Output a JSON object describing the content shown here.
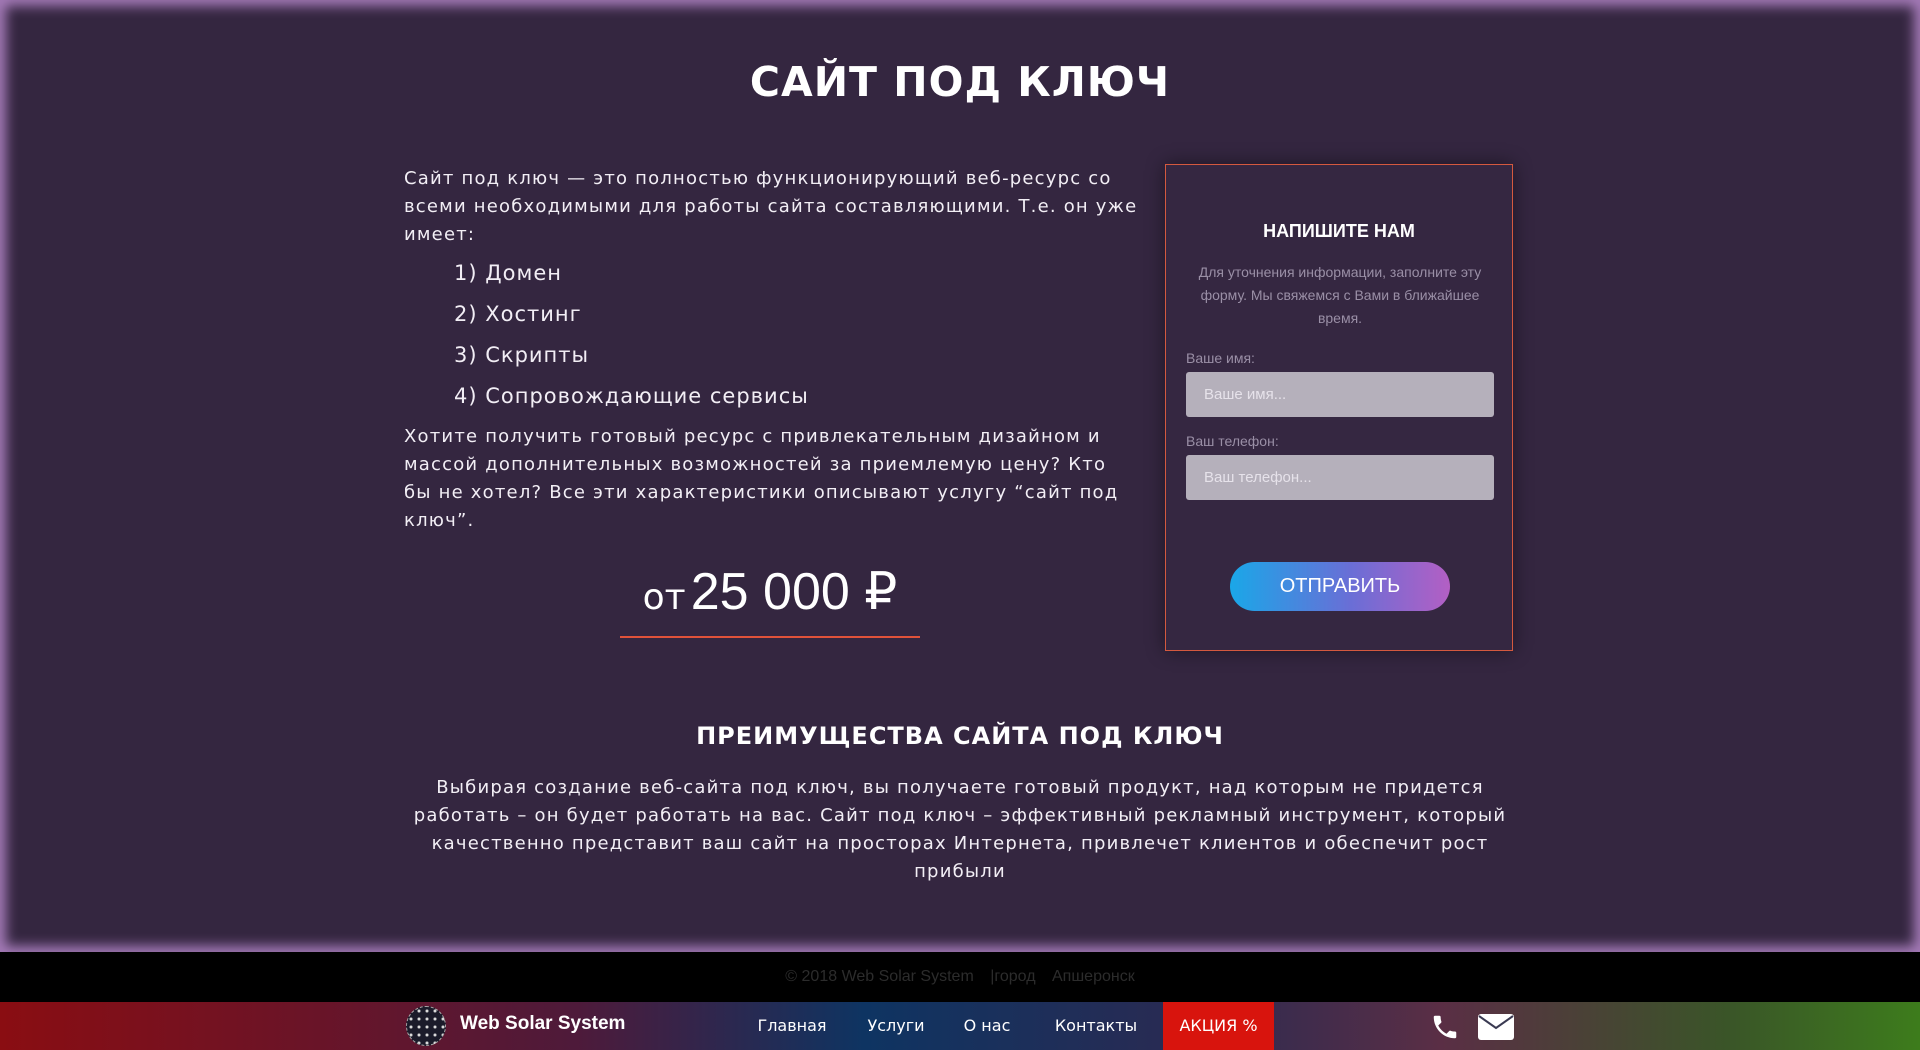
{
  "main": {
    "title": "САЙТ ПОД КЛЮЧ",
    "intro_text": "Сайт под ключ — это полностью функционирующий веб-ресурс со всеми необходимыми для работы сайта составляющими. Т.е. он уже имеет:",
    "features": [
      "1) Домен",
      "2) Хостинг",
      "3) Скрипты",
      "4) Сопровождающие сервисы"
    ],
    "outro_text": "Хотите получить готовый ресурс с привлекательным дизайном и массой дополнительных возможностей за приемлемую цену? Кто бы не хотел? Все эти характеристики описывают услугу “сайт под ключ”.",
    "price_prefix": "от",
    "price_value": "25 000 ₽"
  },
  "form": {
    "title": "НАПИШИТЕ НАМ",
    "description": "Для уточнения информации, заполните эту форму. Мы свяжемся с Вами в ближайшее время.",
    "name_label": "Ваше имя:",
    "name_placeholder": "Ваше имя...",
    "phone_label": "Ваш телефон:",
    "phone_placeholder": "Ваш телефон...",
    "submit_label": "ОТПРАВИТЬ"
  },
  "advantages": {
    "title": "ПРЕИМУЩЕСТВА САЙТА ПОД КЛЮЧ",
    "text": "Выбирая создание веб-сайта под ключ, вы получаете готовый продукт, над которым не придется работать – он будет работать на вас. Сайт под ключ – эффективный рекламный инструмент, который качественно представит ваш сайт на просторах Интернета, привлечет клиентов и обеспечит рост прибыли"
  },
  "footer": {
    "copyright": "© 2018 Web Solar System",
    "city": "|город",
    "city_name": "Апшеронск"
  },
  "navbar": {
    "brand": "Web Solar System",
    "items": [
      "Главная",
      "Услуги",
      "О нас",
      "Контакты"
    ],
    "promo": "АКЦИЯ %",
    "icons": [
      "phone-icon",
      "envelope-icon"
    ]
  },
  "colors": {
    "background": "#342640",
    "accent": "#e0523a",
    "promo": "#d8140d",
    "button_gradient_start": "#1aa7e8",
    "button_gradient_end": "#b35fc4"
  }
}
